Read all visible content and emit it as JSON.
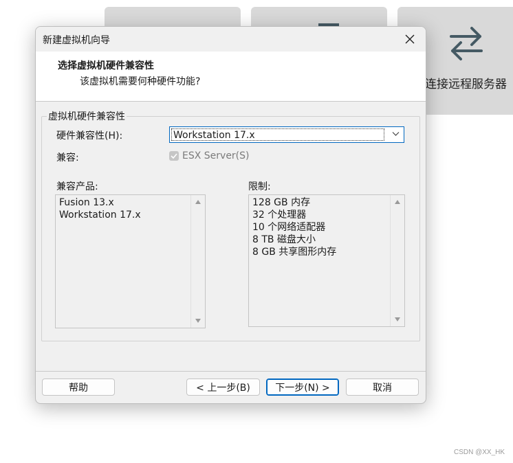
{
  "background": {
    "tile3_label": "连接远程服务器"
  },
  "dialog": {
    "title": "新建虚拟机向导",
    "header_title": "选择虚拟机硬件兼容性",
    "header_subtitle": "该虚拟机需要何种硬件功能?",
    "group_label": "虚拟机硬件兼容性",
    "hw_compat_label": "硬件兼容性(H):",
    "hw_compat_value": "Workstation 17.x",
    "compat_label": "兼容:",
    "esx_label": "ESX Server(S)",
    "products_label": "兼容产品:",
    "products": [
      "Fusion 13.x",
      "Workstation 17.x"
    ],
    "limits_label": "限制:",
    "limits": [
      "128 GB 内存",
      "32 个处理器",
      "10 个网络适配器",
      "8 TB 磁盘大小",
      "8 GB 共享图形内存"
    ],
    "buttons": {
      "help": "帮助",
      "back": "< 上一步(B)",
      "next": "下一步(N) >",
      "cancel": "取消"
    }
  },
  "watermark": "CSDN @XX_HK",
  "colors": {
    "accent": "#0067c0",
    "dialog_bg": "#f0f0f0",
    "tile_bg": "#d9d9d9"
  }
}
